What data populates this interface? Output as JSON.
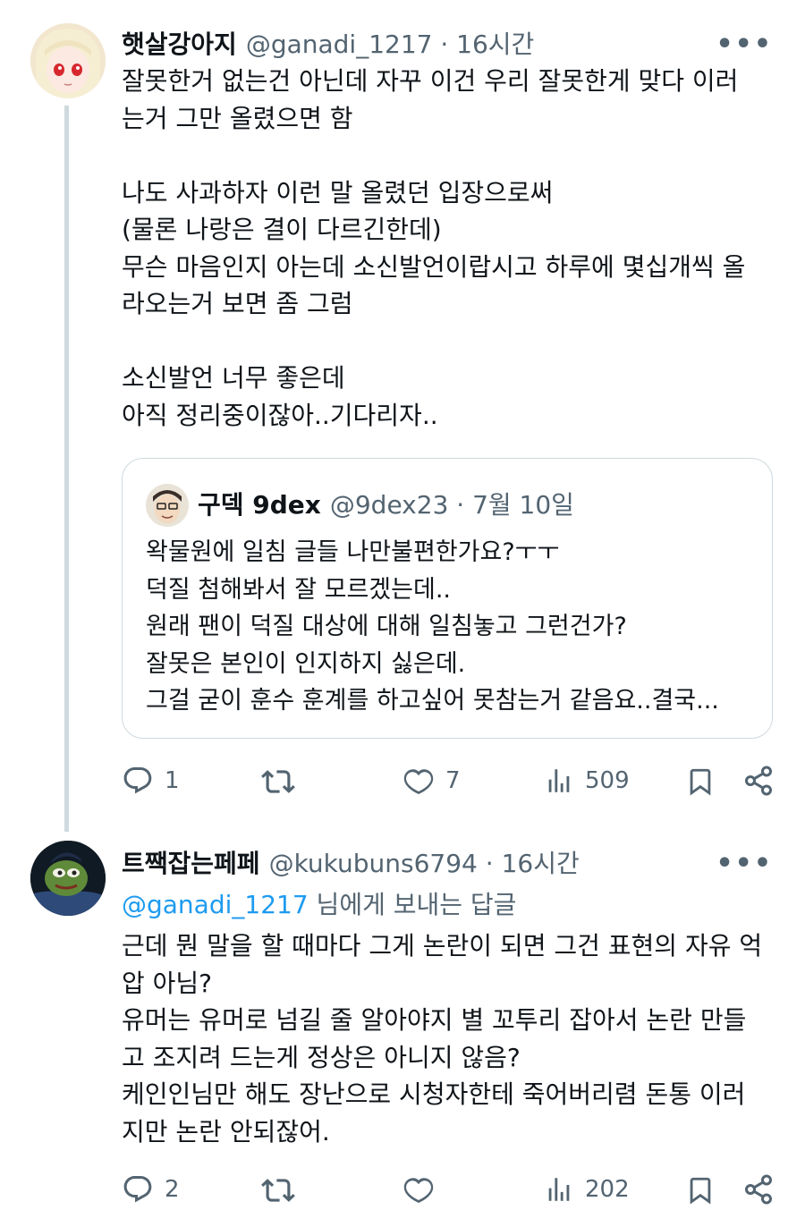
{
  "tweet1": {
    "display_name": "햇살강아지",
    "meta": "@ganadi_1217 · 16시간",
    "more": "•••",
    "body": "잘못한거 없는건 아닌데 자꾸 이건 우리 잘못한게 맞다 이러\n는거 그만 올렸으면 함\n\n나도 사과하자 이런 말 올렸던 입장으로써\n(물론 나랑은 결이 다르긴한데)\n무슨 마음인지 아는데 소신발언이랍시고 하루에 몇십개씩 올\n라오는거 보면 좀 그럼\n\n소신발언 너무 좋은데\n아직 정리중이잖아..기다리자..",
    "quote": {
      "display_name": "구덱 9dex",
      "meta": "@9dex23 · 7월 10일",
      "body": "왁물원에 일침 글들 나만불편한가요?ㅜㅜ\n덕질 첨해봐서 잘 모르겠는데..\n원래 팬이 덕질 대상에 대해 일침놓고 그런건가?\n잘못은 본인이 인지하지 싫은데.\n그걸 굳이 훈수 훈계를 하고싶어 못참는거 같음요..결국..."
    },
    "actions": {
      "replies": "1",
      "retweets": "",
      "likes": "7",
      "views": "509"
    }
  },
  "tweet2": {
    "display_name": "트짹잡는페페",
    "meta": "@kukubuns6794 · 16시간",
    "more": "•••",
    "replying_mention": "@ganadi_1217",
    "replying_suffix": " 님에게 보내는 답글",
    "body": "근데 뭔 말을 할 때마다 그게 논란이 되면 그건 표현의 자유 억\n압 아님?\n유머는 유머로 넘길 줄 알아야지 별 꼬투리 잡아서 논란 만들\n고 조지려 드는게 정상은 아니지 않음?\n케인인님만 해도 장난으로 시청자한테 죽어버리렴 돈통 이러\n지만 논란 안되잖어.",
    "actions": {
      "replies": "2",
      "retweets": "",
      "likes": "",
      "views": "202"
    }
  },
  "colors": {
    "text": "#0f1419",
    "secondary": "#536471",
    "link": "#1d9bf0",
    "border": "#cfd9de"
  },
  "icons": [
    "reply-icon",
    "retweet-icon",
    "like-icon",
    "views-icon",
    "bookmark-icon",
    "share-icon",
    "more-icon"
  ]
}
